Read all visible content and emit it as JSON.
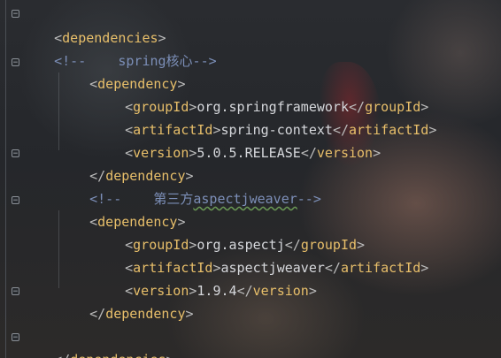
{
  "lines": {
    "l1": {
      "open": "<",
      "name": "dependencies",
      "close": ">"
    },
    "l2": {
      "comment": "<!--    spring核心-->"
    },
    "l3": {
      "open": "<",
      "name": "dependency",
      "close": ">"
    },
    "l4": {
      "tag": "groupId",
      "value": "org.springframework",
      "endtag": "groupId"
    },
    "l5": {
      "tag": "artifactId",
      "value": "spring-context",
      "endtag": "artifactId"
    },
    "l6": {
      "tag": "version",
      "value": "5.0.5.RELEASE",
      "endtag": "version"
    },
    "l7": {
      "open": "</",
      "name": "dependency",
      "close": ">"
    },
    "l8": {
      "comment_start": "<!--    第三方",
      "comment_word": "aspectjweaver",
      "comment_end": "-->"
    },
    "l9": {
      "open": "<",
      "name": "dependency",
      "close": ">"
    },
    "l10": {
      "tag": "groupId",
      "value": "org.aspectj",
      "endtag": "groupId"
    },
    "l11": {
      "tag": "artifactId",
      "value": "aspectjweaver",
      "endtag": "artifactId"
    },
    "l12": {
      "tag": "version",
      "value": "1.9.4",
      "endtag": "version"
    },
    "l13": {
      "open": "</",
      "name": "dependency",
      "close": ">"
    },
    "l15": {
      "open": "</",
      "name": "dependencies",
      "close": ">"
    }
  },
  "fold_markers": {
    "open": "−",
    "close": "−"
  },
  "colors": {
    "tag": "#e8bf6a",
    "bracket": "#bbbbbb",
    "text": "#d6d8dc",
    "comment": "#7c8fb8"
  }
}
